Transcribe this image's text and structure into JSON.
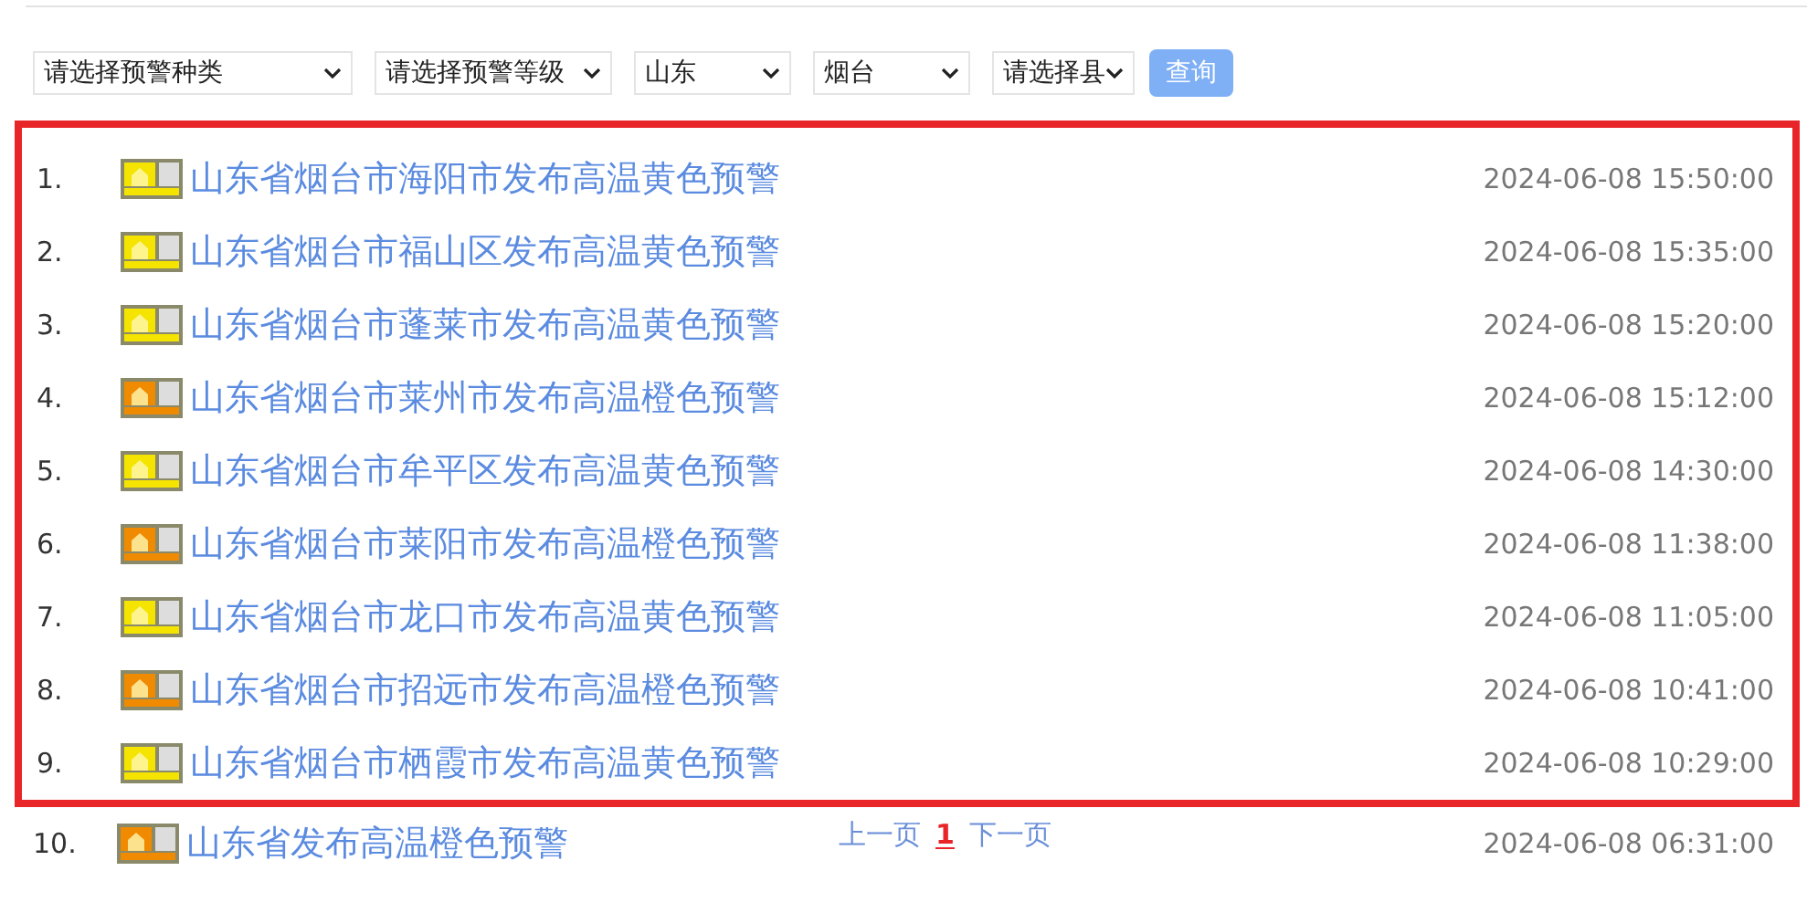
{
  "filters": [
    {
      "value": "请选择预警种类"
    },
    {
      "value": "请选择预警等级"
    },
    {
      "value": "山东"
    },
    {
      "value": "烟台"
    },
    {
      "value": "请选择县"
    }
  ],
  "search_button": "查询",
  "alerts": [
    {
      "index": "1.",
      "title": "山东省烟台市海阳市发布高温黄色预警",
      "time": "2024-06-08 15:50:00",
      "color": "#f5e400",
      "highlighted": true
    },
    {
      "index": "2.",
      "title": "山东省烟台市福山区发布高温黄色预警",
      "time": "2024-06-08 15:35:00",
      "color": "#f5e400",
      "highlighted": true
    },
    {
      "index": "3.",
      "title": "山东省烟台市蓬莱市发布高温黄色预警",
      "time": "2024-06-08 15:20:00",
      "color": "#f5e400",
      "highlighted": true
    },
    {
      "index": "4.",
      "title": "山东省烟台市莱州市发布高温橙色预警",
      "time": "2024-06-08 15:12:00",
      "color": "#f08a00",
      "highlighted": true
    },
    {
      "index": "5.",
      "title": "山东省烟台市牟平区发布高温黄色预警",
      "time": "2024-06-08 14:30:00",
      "color": "#f5e400",
      "highlighted": true
    },
    {
      "index": "6.",
      "title": "山东省烟台市莱阳市发布高温橙色预警",
      "time": "2024-06-08 11:38:00",
      "color": "#f08a00",
      "highlighted": true
    },
    {
      "index": "7.",
      "title": "山东省烟台市龙口市发布高温黄色预警",
      "time": "2024-06-08 11:05:00",
      "color": "#f5e400",
      "highlighted": true
    },
    {
      "index": "8.",
      "title": "山东省烟台市招远市发布高温橙色预警",
      "time": "2024-06-08 10:41:00",
      "color": "#f08a00",
      "highlighted": true
    },
    {
      "index": "9.",
      "title": "山东省烟台市栖霞市发布高温黄色预警",
      "time": "2024-06-08 10:29:00",
      "color": "#f5e400",
      "highlighted": true
    },
    {
      "index": "10.",
      "title": "山东省发布高温橙色预警",
      "time": "2024-06-08 06:31:00",
      "color": "#f08a00",
      "highlighted": false
    }
  ],
  "pagination": {
    "prev": "上一页",
    "page": "1",
    "next": "下一页"
  }
}
